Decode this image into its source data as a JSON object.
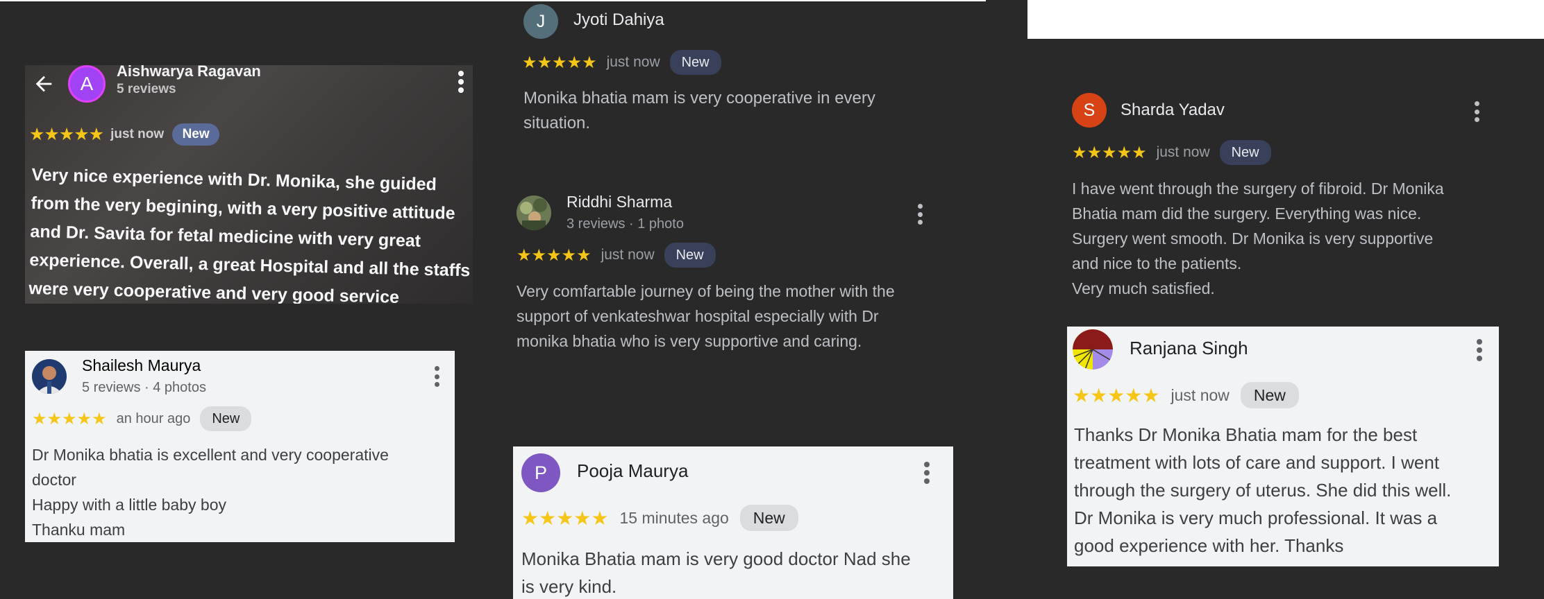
{
  "reviews": {
    "aishwarya": {
      "avatar_letter": "A",
      "name": "Aishwarya Ragavan",
      "meta": "5 reviews",
      "stars": "★★★★★",
      "time": "just now",
      "badge": "New",
      "lines": [
        "Very nice experience with Dr. Monika, she guided",
        "from the very begining, with a very positive attitude",
        "and Dr. Savita for fetal medicine with very great",
        "experience. Overall, a great Hospital and all the staffs",
        "were very cooperative and very good service"
      ]
    },
    "shailesh": {
      "name": "Shailesh Maurya",
      "meta": "5 reviews · 4 photos",
      "stars": "★★★★★",
      "time": "an hour ago",
      "badge": "New",
      "lines": [
        "Dr Monika bhatia is excellent and very cooperative",
        "doctor",
        "Happy with a little baby boy",
        "Thanku mam"
      ]
    },
    "jyoti": {
      "avatar_letter": "J",
      "name": "Jyoti Dahiya",
      "stars": "★★★★★",
      "time": "just now",
      "badge": "New",
      "lines": [
        "Monika bhatia mam is very cooperative in every",
        "situation."
      ]
    },
    "riddhi": {
      "name": "Riddhi Sharma",
      "meta": "3 reviews · 1 photo",
      "stars": "★★★★★",
      "time": "just now",
      "badge": "New",
      "lines": [
        "Very comfartable journey of being the mother with the",
        "support of venkateshwar hospital especially with Dr",
        "monika bhatia who is very supportive and caring."
      ]
    },
    "pooja": {
      "avatar_letter": "P",
      "name": "Pooja Maurya",
      "stars": "★★★★★",
      "time": "15 minutes ago",
      "badge": "New",
      "lines": [
        "Monika Bhatia mam is very good doctor Nad she",
        "is very kind."
      ]
    },
    "sharda": {
      "avatar_letter": "S",
      "name": "Sharda Yadav",
      "stars": "★★★★★",
      "time": "just now",
      "badge": "New",
      "lines": [
        "I have went through the surgery of fibroid. Dr Monika",
        "Bhatia mam did the surgery. Everything was nice.",
        "Surgery went smooth. Dr Monika is very supportive",
        "and nice to the patients.",
        "Very much satisfied."
      ]
    },
    "ranjana": {
      "name": "Ranjana Singh",
      "stars": "★★★★★",
      "time": "just now",
      "badge": "New",
      "lines": [
        "Thanks Dr Monika Bhatia mam for the best",
        "treatment with lots of care and support. I went",
        "through the surgery of uterus. She did this well.",
        "Dr Monika is very much professional. It was a",
        "good experience with her. Thanks"
      ]
    }
  },
  "colors": {
    "background": "#292929",
    "star": "#f5c518",
    "avatar_a": "#a142f4",
    "avatar_j": "#546e7a",
    "avatar_p": "#7e57c2",
    "avatar_s": "#d84315"
  },
  "icons": {
    "back": "back-arrow-icon",
    "more": "more-vert-icon"
  }
}
